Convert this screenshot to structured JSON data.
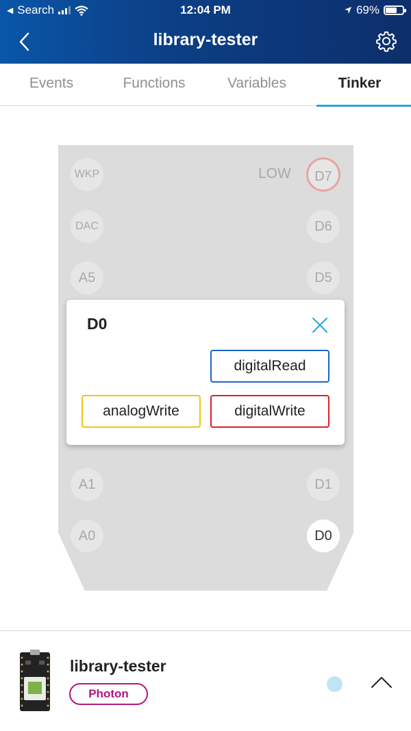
{
  "status_bar": {
    "back_app": "Search",
    "time": "12:04 PM",
    "battery": "69%",
    "battery_level": 0.69
  },
  "nav": {
    "title": "library-tester",
    "back_icon": "chevron-left-icon",
    "settings_icon": "gear-icon"
  },
  "tabs": [
    {
      "label": "Events"
    },
    {
      "label": "Functions"
    },
    {
      "label": "Variables"
    },
    {
      "label": "Tinker",
      "active": true
    }
  ],
  "board": {
    "left_pins": [
      "WKP",
      "DAC",
      "A5",
      "A1",
      "A0"
    ],
    "right_pins": [
      "D7",
      "D6",
      "D5",
      "D1",
      "D0"
    ],
    "d7_state": "LOW"
  },
  "popup": {
    "title": "D0",
    "buttons": {
      "digital_read": "digitalRead",
      "analog_write": "analogWrite",
      "digital_write": "digitalWrite"
    },
    "colors": {
      "digital_read": "#1d63c9",
      "analog_write": "#f1c313",
      "digital_write": "#d92126"
    }
  },
  "device": {
    "name": "library-tester",
    "type": "Photon",
    "badge_color": "#b1177d"
  },
  "colors": {
    "header_start": "#0a56a8",
    "header_end": "#0d2f6b",
    "tab_accent": "#2aa4dd"
  }
}
